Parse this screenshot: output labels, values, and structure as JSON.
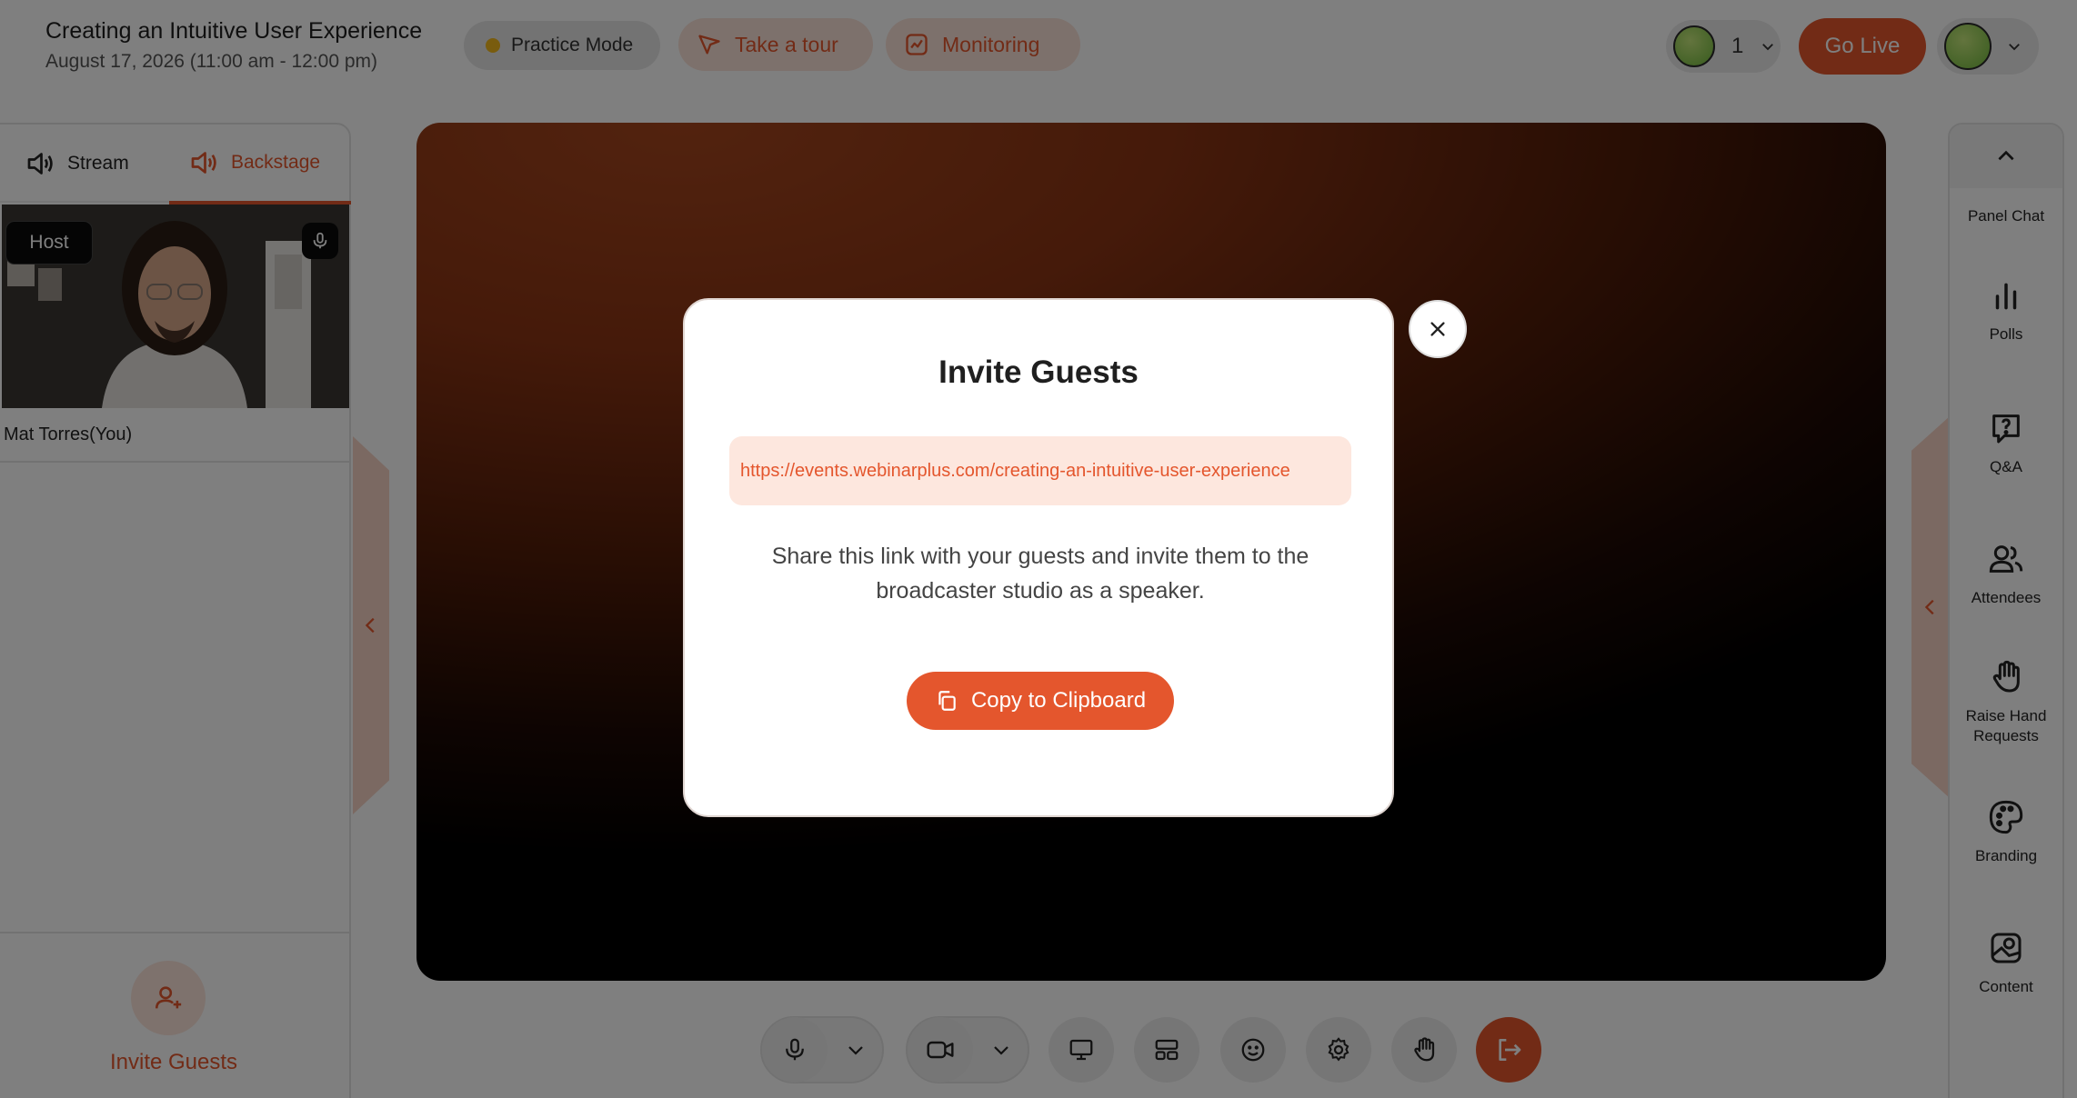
{
  "header": {
    "event_title": "Creating an Intuitive User Experience",
    "event_date": "August 17, 2026 (11:00 am - 12:00 pm)",
    "practice_mode_label": "Practice Mode",
    "take_tour_label": "Take a tour",
    "monitoring_label": "Monitoring",
    "viewer_count": "1",
    "go_live_label": "Go Live"
  },
  "left_panel": {
    "tabs": [
      {
        "label": "Stream",
        "active": false
      },
      {
        "label": "Backstage",
        "active": true
      }
    ],
    "participant": {
      "role_tag": "Host",
      "name": "Mat Torres(You)"
    },
    "invite_label": "Invite Guests"
  },
  "right_rail": {
    "items": [
      {
        "label": "Panel Chat",
        "icon": "chat-icon"
      },
      {
        "label": "Polls",
        "icon": "polls-icon"
      },
      {
        "label": "Q&A",
        "icon": "qa-icon"
      },
      {
        "label": "Attendees",
        "icon": "attendees-icon"
      },
      {
        "label": "Raise Hand Requests",
        "icon": "raise-hand-icon"
      },
      {
        "label": "Branding",
        "icon": "palette-icon"
      },
      {
        "label": "Content",
        "icon": "content-icon"
      }
    ]
  },
  "toolbar": {
    "buttons": [
      "mic-icon",
      "chevron-down-icon",
      "camera-icon",
      "chevron-down-icon",
      "screen-share-icon",
      "layout-icon",
      "emoji-icon",
      "settings-icon",
      "raise-hand-icon",
      "leave-icon"
    ]
  },
  "modal": {
    "title": "Invite Guests",
    "link": "https://events.webinarplus.com/creating-an-intuitive-user-experience",
    "description": "Share this link with your guests and invite them to the broadcaster studio as a speaker.",
    "copy_label": "Copy to Clipboard"
  },
  "colors": {
    "accent": "#e4562d",
    "accent_light": "#fde7de",
    "practice_dot": "#f2b81c"
  }
}
